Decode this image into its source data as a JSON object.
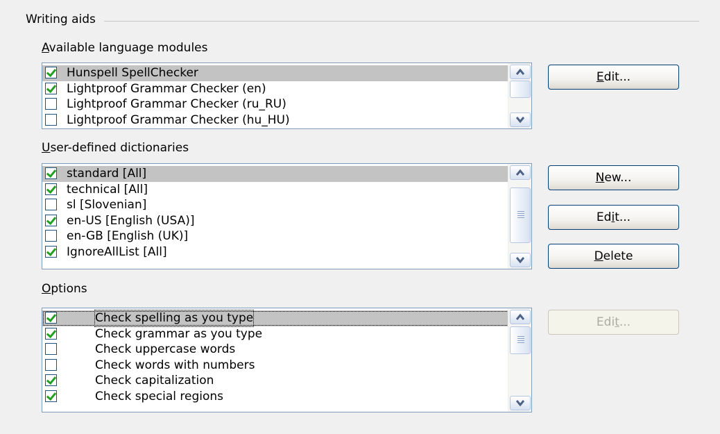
{
  "writing_aids": {
    "title": "Writing aids",
    "language_modules": {
      "label_key": "A",
      "label_rest": "vailable language modules",
      "items": [
        {
          "label": "Hunspell SpellChecker",
          "checked": true
        },
        {
          "label": "Lightproof Grammar Checker (en)",
          "checked": true
        },
        {
          "label": "Lightproof Grammar Checker (ru_RU)",
          "checked": false
        },
        {
          "label": "Lightproof Grammar Checker (hu_HU)",
          "checked": false
        }
      ],
      "edit_label_key": "E",
      "edit_label_rest": "dit..."
    },
    "dictionaries": {
      "label_key": "U",
      "label_rest": "ser-defined dictionaries",
      "items": [
        {
          "label": "standard [All]",
          "checked": true
        },
        {
          "label": "technical [All]",
          "checked": true
        },
        {
          "label": "sl [Slovenian]",
          "checked": false
        },
        {
          "label": "en-US [English (USA)]",
          "checked": true
        },
        {
          "label": "en-GB [English (UK)]",
          "checked": false
        },
        {
          "label": "IgnoreAllList [All]",
          "checked": true
        }
      ],
      "new_label_key": "N",
      "new_label_rest": "ew...",
      "edit_label_pre": "Ed",
      "edit_label_key": "i",
      "edit_label_rest": "t...",
      "delete_label_key": "D",
      "delete_label_rest": "elete"
    },
    "options": {
      "label_key": "O",
      "label_rest": "ptions",
      "items": [
        {
          "label": "Check spelling as you type",
          "checked": true
        },
        {
          "label": "Check grammar as you type",
          "checked": true
        },
        {
          "label": "Check uppercase words",
          "checked": false
        },
        {
          "label": "Check words with numbers",
          "checked": false
        },
        {
          "label": "Check capitalization",
          "checked": true
        },
        {
          "label": "Check special regions",
          "checked": true
        }
      ],
      "edit_label_pre": "Edi",
      "edit_label_key": "t",
      "edit_label_rest": "..."
    }
  },
  "colors": {
    "background": "#f0f0f0",
    "selection": "#c3c3c3",
    "check": "#21a121",
    "list_border": "#7f9db9",
    "button_border": "#003c74"
  }
}
